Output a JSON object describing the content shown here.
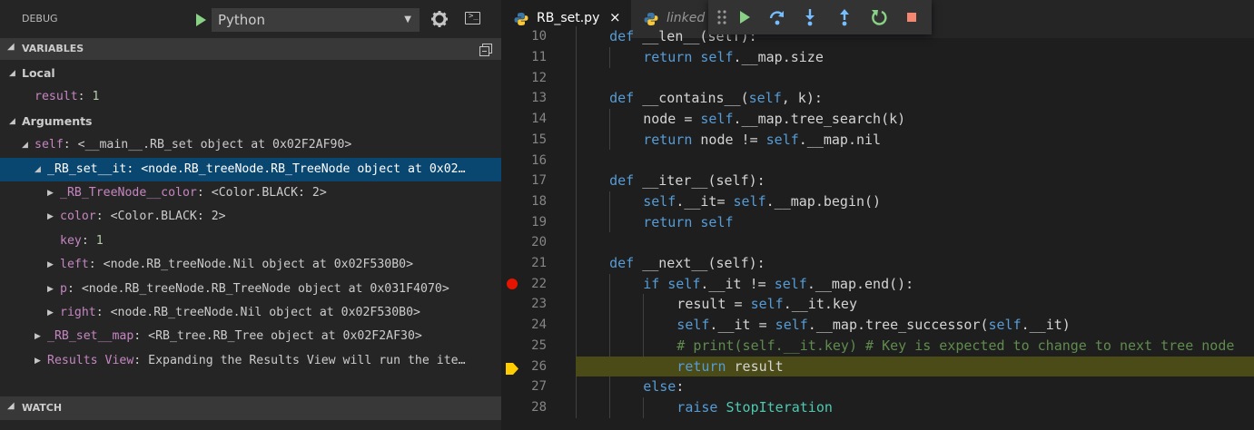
{
  "debug": {
    "title": "DEBUG",
    "config": "Python",
    "run_label": "Start Debugging",
    "settings_label": "Open launch.json",
    "console_label": "Debug Console"
  },
  "variables": {
    "title": "VARIABLES",
    "rows": [
      {
        "kind": "header",
        "twisty": "open",
        "indent": 10,
        "label": "Local"
      },
      {
        "kind": "var",
        "twisty": "none",
        "indent": 24,
        "name": "result",
        "value": "1",
        "value_kind": "num"
      },
      {
        "kind": "header",
        "twisty": "open",
        "indent": 10,
        "label": "Arguments"
      },
      {
        "kind": "var",
        "twisty": "open",
        "indent": 24,
        "name": "self",
        "value": "<__main__.RB_set object at 0x02F2AF90>"
      },
      {
        "kind": "var",
        "twisty": "open",
        "indent": 38,
        "name": "_RB_set__it",
        "value": "<node.RB_treeNode.RB_TreeNode object at 0x02…",
        "selected": true
      },
      {
        "kind": "var",
        "twisty": "closed",
        "indent": 52,
        "name": "_RB_TreeNode__color",
        "value": "<Color.BLACK: 2>"
      },
      {
        "kind": "var",
        "twisty": "closed",
        "indent": 52,
        "name": "color",
        "value": "<Color.BLACK: 2>"
      },
      {
        "kind": "var",
        "twisty": "none",
        "indent": 52,
        "name": "key",
        "value": "1",
        "value_kind": "num"
      },
      {
        "kind": "var",
        "twisty": "closed",
        "indent": 52,
        "name": "left",
        "value": "<node.RB_treeNode.Nil object at 0x02F530B0>"
      },
      {
        "kind": "var",
        "twisty": "closed",
        "indent": 52,
        "name": "p",
        "value": "<node.RB_treeNode.RB_TreeNode object at 0x031F4070>"
      },
      {
        "kind": "var",
        "twisty": "closed",
        "indent": 52,
        "name": "right",
        "value": "<node.RB_treeNode.Nil object at 0x02F530B0>"
      },
      {
        "kind": "var",
        "twisty": "closed",
        "indent": 38,
        "name": "_RB_set__map",
        "value": "<RB_tree.RB_Tree object at 0x02F2AF30>"
      },
      {
        "kind": "var",
        "twisty": "closed",
        "indent": 38,
        "name": "Results View",
        "value": "Expanding the Results View will run the ite…"
      }
    ]
  },
  "watch": {
    "title": "WATCH"
  },
  "tabs": [
    {
      "name": "RB_set.py",
      "close": "×",
      "active": true
    },
    {
      "name": "linked",
      "active": false
    }
  ],
  "toolbar": [
    "drag-handle",
    "continue",
    "step-over",
    "step-into",
    "step-out",
    "restart",
    "stop"
  ],
  "editor": {
    "first_visible_line": 10,
    "breakpoint_line": 22,
    "current_line": 26,
    "lines": [
      {
        "n": 10,
        "indent": 1,
        "tokens": [
          [
            "kw",
            "def "
          ],
          [
            "ident",
            "__len__(self):"
          ]
        ]
      },
      {
        "n": 11,
        "indent": 2,
        "tokens": [
          [
            "kw",
            "return "
          ],
          [
            "kw",
            "self"
          ],
          [
            "ident",
            ".__map.size"
          ]
        ]
      },
      {
        "n": 12,
        "indent": 0,
        "tokens": []
      },
      {
        "n": 13,
        "indent": 1,
        "tokens": [
          [
            "kw",
            "def "
          ],
          [
            "ident",
            "__contains__("
          ],
          [
            "kw",
            "self"
          ],
          [
            "ident",
            ", k):"
          ]
        ]
      },
      {
        "n": 14,
        "indent": 2,
        "tokens": [
          [
            "ident",
            "node = "
          ],
          [
            "kw",
            "self"
          ],
          [
            "ident",
            ".__map.tree_search(k)"
          ]
        ]
      },
      {
        "n": 15,
        "indent": 2,
        "tokens": [
          [
            "kw",
            "return "
          ],
          [
            "ident",
            "node != "
          ],
          [
            "kw",
            "self"
          ],
          [
            "ident",
            ".__map.nil"
          ]
        ]
      },
      {
        "n": 16,
        "indent": 0,
        "tokens": []
      },
      {
        "n": 17,
        "indent": 1,
        "tokens": [
          [
            "kw",
            "def "
          ],
          [
            "ident",
            "__iter__(self):"
          ]
        ]
      },
      {
        "n": 18,
        "indent": 2,
        "tokens": [
          [
            "kw",
            "self"
          ],
          [
            "ident",
            ".__it= "
          ],
          [
            "kw",
            "self"
          ],
          [
            "ident",
            ".__map.begin()"
          ]
        ]
      },
      {
        "n": 19,
        "indent": 2,
        "tokens": [
          [
            "kw",
            "return "
          ],
          [
            "kw",
            "self"
          ]
        ]
      },
      {
        "n": 20,
        "indent": 0,
        "tokens": []
      },
      {
        "n": 21,
        "indent": 1,
        "tokens": [
          [
            "kw",
            "def "
          ],
          [
            "ident",
            "__next__(self):"
          ]
        ]
      },
      {
        "n": 22,
        "indent": 2,
        "tokens": [
          [
            "kw",
            "if "
          ],
          [
            "kw",
            "self"
          ],
          [
            "ident",
            ".__it != "
          ],
          [
            "kw",
            "self"
          ],
          [
            "ident",
            ".__map.end():"
          ]
        ]
      },
      {
        "n": 23,
        "indent": 3,
        "tokens": [
          [
            "ident",
            "result = "
          ],
          [
            "kw",
            "self"
          ],
          [
            "ident",
            ".__it.key"
          ]
        ]
      },
      {
        "n": 24,
        "indent": 3,
        "tokens": [
          [
            "kw",
            "self"
          ],
          [
            "ident",
            ".__it = "
          ],
          [
            "kw",
            "self"
          ],
          [
            "ident",
            ".__map.tree_successor("
          ],
          [
            "kw",
            "self"
          ],
          [
            "ident",
            ".__it)"
          ]
        ]
      },
      {
        "n": 25,
        "indent": 3,
        "tokens": [
          [
            "cm",
            "# print(self.__it.key) # Key is expected to change to next tree node"
          ]
        ]
      },
      {
        "n": 26,
        "indent": 3,
        "tokens": [
          [
            "kw",
            "return "
          ],
          [
            "ident",
            "result"
          ]
        ]
      },
      {
        "n": 27,
        "indent": 2,
        "tokens": [
          [
            "kw",
            "else"
          ],
          [
            "ident",
            ":"
          ]
        ]
      },
      {
        "n": 28,
        "indent": 3,
        "tokens": [
          [
            "kw",
            "raise "
          ],
          [
            "ty",
            "StopIteration"
          ]
        ]
      }
    ]
  }
}
